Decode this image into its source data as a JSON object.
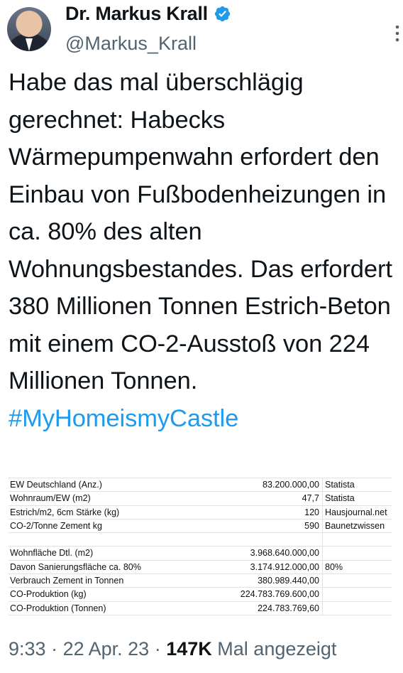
{
  "author": {
    "display_name": "Dr. Markus Krall",
    "handle": "@Markus_Krall",
    "verified_icon": "verified-badge-icon",
    "verified_color": "#1d9bf0"
  },
  "tweet": {
    "text": "Habe das mal überschlägig gerechnet: Habecks Wärmepumpenwahn erfordert den Einbau von Fußbodenheizungen in ca. 80% des alten Wohnungsbestandes. Das erfordert 380 Millionen Tonnen Estrich-Beton mit einem CO-2-Ausstoß von 224 Millionen Tonnen.",
    "hashtag": "#MyHomeismyCastle",
    "hashtag_color": "#1d9bf0"
  },
  "spreadsheet": {
    "rows": [
      {
        "label": "EW Deutschland (Anz.)",
        "value": "83.200.000,00",
        "source": "Statista"
      },
      {
        "label": "Wohnraum/EW (m2)",
        "value": "47,7",
        "source": "Statista"
      },
      {
        "label": "Estrich/m2, 6cm Stärke (kg)",
        "value": "120",
        "source": "Hausjournal.net"
      },
      {
        "label": "CO-2/Tonne Zement kg",
        "value": "590",
        "source": "Baunetzwissen"
      },
      {
        "label": "",
        "value": "",
        "source": ""
      },
      {
        "label": "Wohnfläche Dtl. (m2)",
        "value": "3.968.640.000,00",
        "source": ""
      },
      {
        "label": "Davon Sanierungsfläche ca. 80%",
        "value": "3.174.912.000,00",
        "source": "80%"
      },
      {
        "label": "Verbrauch Zement in Tonnen",
        "value": "380.989.440,00",
        "source": ""
      },
      {
        "label": "CO-Produktion (kg)",
        "value": "224.783.769.600,00",
        "source": ""
      },
      {
        "label": "CO-Produktion (Tonnen)",
        "value": "224.783.769,60",
        "source": ""
      }
    ]
  },
  "meta": {
    "time": "9:33",
    "date": "22 Apr. 23",
    "views_count": "147K",
    "views_label": "Mal angezeigt",
    "separator": "·"
  }
}
